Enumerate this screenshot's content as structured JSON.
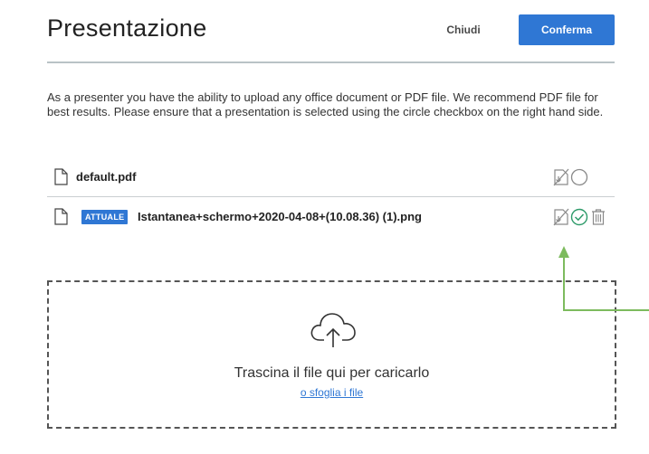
{
  "header": {
    "title": "Presentazione",
    "close_label": "Chiudi",
    "confirm_label": "Conferma"
  },
  "description": "As a presenter you have the ability to upload any office document or PDF file. We recommend PDF file for best results. Please ensure that a presentation is selected using the circle checkbox on the right hand side.",
  "files": [
    {
      "name": "default.pdf",
      "current": false
    },
    {
      "badge": "ATTUALE",
      "name": "Istantanea+schermo+2020-04-08+(10.08.36) (1).png",
      "current": true
    }
  ],
  "dropzone": {
    "text": "Trascina il file qui per caricarlo",
    "browse_link": "o sfoglia i file"
  },
  "icons": {
    "file": "file-icon",
    "download_toggle": "no-download-icon",
    "select_empty": "circle-radio-icon",
    "select_checked": "check-circle-icon",
    "delete": "trash-icon",
    "upload": "cloud-upload-icon"
  },
  "colors": {
    "accent": "#2f77d4",
    "selected": "#2e9b6a",
    "annotation": "#7dbb5e",
    "icon_gray": "#8a8a8a"
  }
}
